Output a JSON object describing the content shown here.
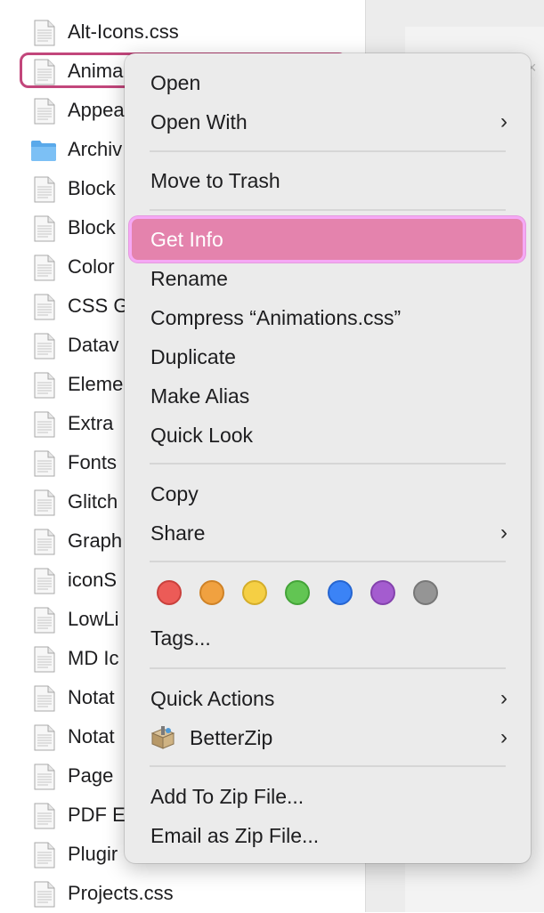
{
  "files": [
    {
      "name": "Alt-Icons.css",
      "type": "file"
    },
    {
      "name": "Anima",
      "type": "file",
      "selected": true
    },
    {
      "name": "Appea",
      "type": "file"
    },
    {
      "name": "Archiv",
      "type": "folder"
    },
    {
      "name": "Block",
      "type": "file"
    },
    {
      "name": "Block",
      "type": "file"
    },
    {
      "name": "Color",
      "type": "file"
    },
    {
      "name": "CSS G",
      "type": "file"
    },
    {
      "name": "Datav",
      "type": "file"
    },
    {
      "name": "Eleme",
      "type": "file"
    },
    {
      "name": "Extra",
      "type": "file"
    },
    {
      "name": "Fonts",
      "type": "file"
    },
    {
      "name": "Glitch",
      "type": "file"
    },
    {
      "name": "Graph",
      "type": "file"
    },
    {
      "name": "iconS",
      "type": "file"
    },
    {
      "name": "LowLi",
      "type": "file"
    },
    {
      "name": "MD Ic",
      "type": "file"
    },
    {
      "name": "Notat",
      "type": "file"
    },
    {
      "name": "Notat",
      "type": "file"
    },
    {
      "name": "Page",
      "type": "file"
    },
    {
      "name": "PDF E",
      "type": "file"
    },
    {
      "name": "Plugir",
      "type": "file"
    },
    {
      "name": "Projects.css",
      "type": "file"
    }
  ],
  "menu": {
    "open": "Open",
    "open_with": "Open With",
    "move_to_trash": "Move to Trash",
    "get_info": "Get Info",
    "rename": "Rename",
    "compress": "Compress “Animations.css”",
    "duplicate": "Duplicate",
    "make_alias": "Make Alias",
    "quick_look": "Quick Look",
    "copy": "Copy",
    "share": "Share",
    "tags": "Tags...",
    "quick_actions": "Quick Actions",
    "betterzip": "BetterZip",
    "add_to_zip": "Add To Zip File...",
    "email_as_zip": "Email as Zip File...",
    "chevron": "›",
    "tag_colors": [
      {
        "name": "red",
        "fill": "#ec5b57",
        "stroke": "#c9403c"
      },
      {
        "name": "orange",
        "fill": "#f0a140",
        "stroke": "#cf8226"
      },
      {
        "name": "yellow",
        "fill": "#f5cf44",
        "stroke": "#d4ad2a"
      },
      {
        "name": "green",
        "fill": "#62c553",
        "stroke": "#44a438"
      },
      {
        "name": "blue",
        "fill": "#3b83f6",
        "stroke": "#2565d1"
      },
      {
        "name": "purple",
        "fill": "#a45ccf",
        "stroke": "#8442ad"
      },
      {
        "name": "gray",
        "fill": "#959595",
        "stroke": "#777777"
      }
    ]
  },
  "colors": {
    "highlight": "#e483ad",
    "selection_outline": "#c2467b"
  },
  "window": {
    "close_glyph": "×"
  }
}
